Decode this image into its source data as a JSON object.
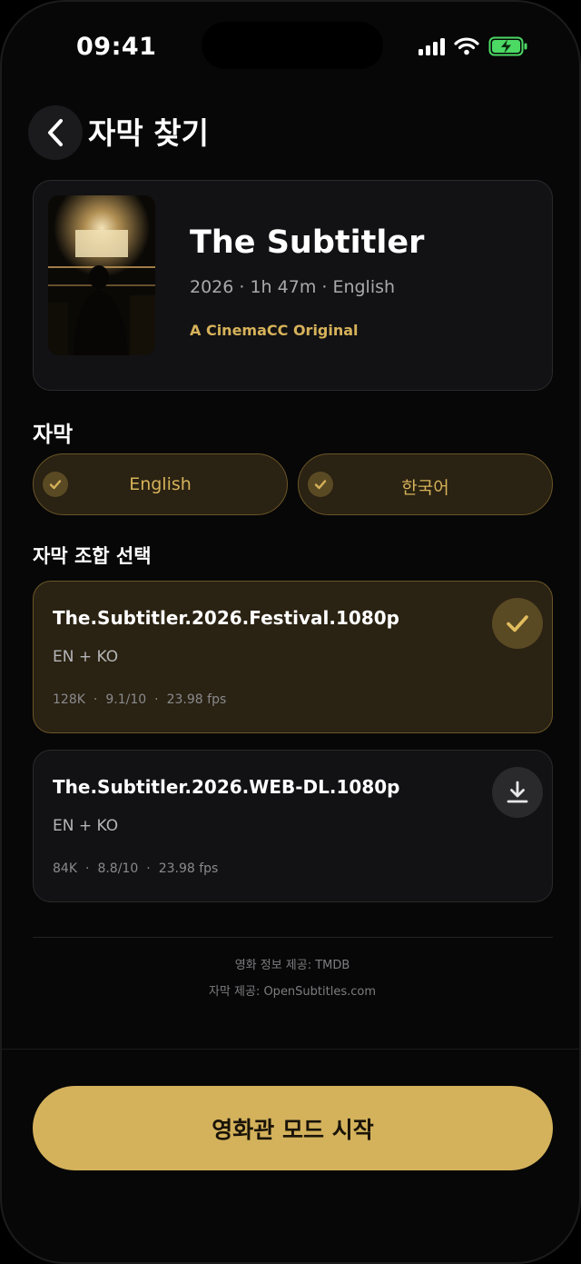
{
  "status_bar": {
    "time": "09:41"
  },
  "header": {
    "title": "자막 찾기"
  },
  "movie": {
    "title": "The Subtitler",
    "meta": "2026 · 1h 47m · English",
    "origin": "A CinemaCC Original"
  },
  "subtitles_section": {
    "title": "자막",
    "languages": [
      {
        "label": "English",
        "selected": true
      },
      {
        "label": "한국어",
        "selected": true
      }
    ]
  },
  "combo_section": {
    "title": "자막 조합 선택",
    "items": [
      {
        "name": "The.Subtitler.2026.Festival.1080p",
        "langs": "EN + KO",
        "downloads": "128K",
        "rating": "9.1/10",
        "fps": "23.98 fps",
        "state": "selected"
      },
      {
        "name": "The.Subtitler.2026.WEB-DL.1080p",
        "langs": "EN + KO",
        "downloads": "84K",
        "rating": "8.8/10",
        "fps": "23.98 fps",
        "state": "download"
      }
    ]
  },
  "credits": {
    "movie_info": "영화 정보 제공: TMDB",
    "subtitles": "자막 제공: OpenSubtitles.com"
  },
  "cta": {
    "label": "영화관 모드 시작"
  },
  "colors": {
    "accent": "#d4b25c",
    "accent_text": "#d7b25a",
    "background": "#070707",
    "card": "#121214",
    "selected_card": "#2a2212"
  }
}
